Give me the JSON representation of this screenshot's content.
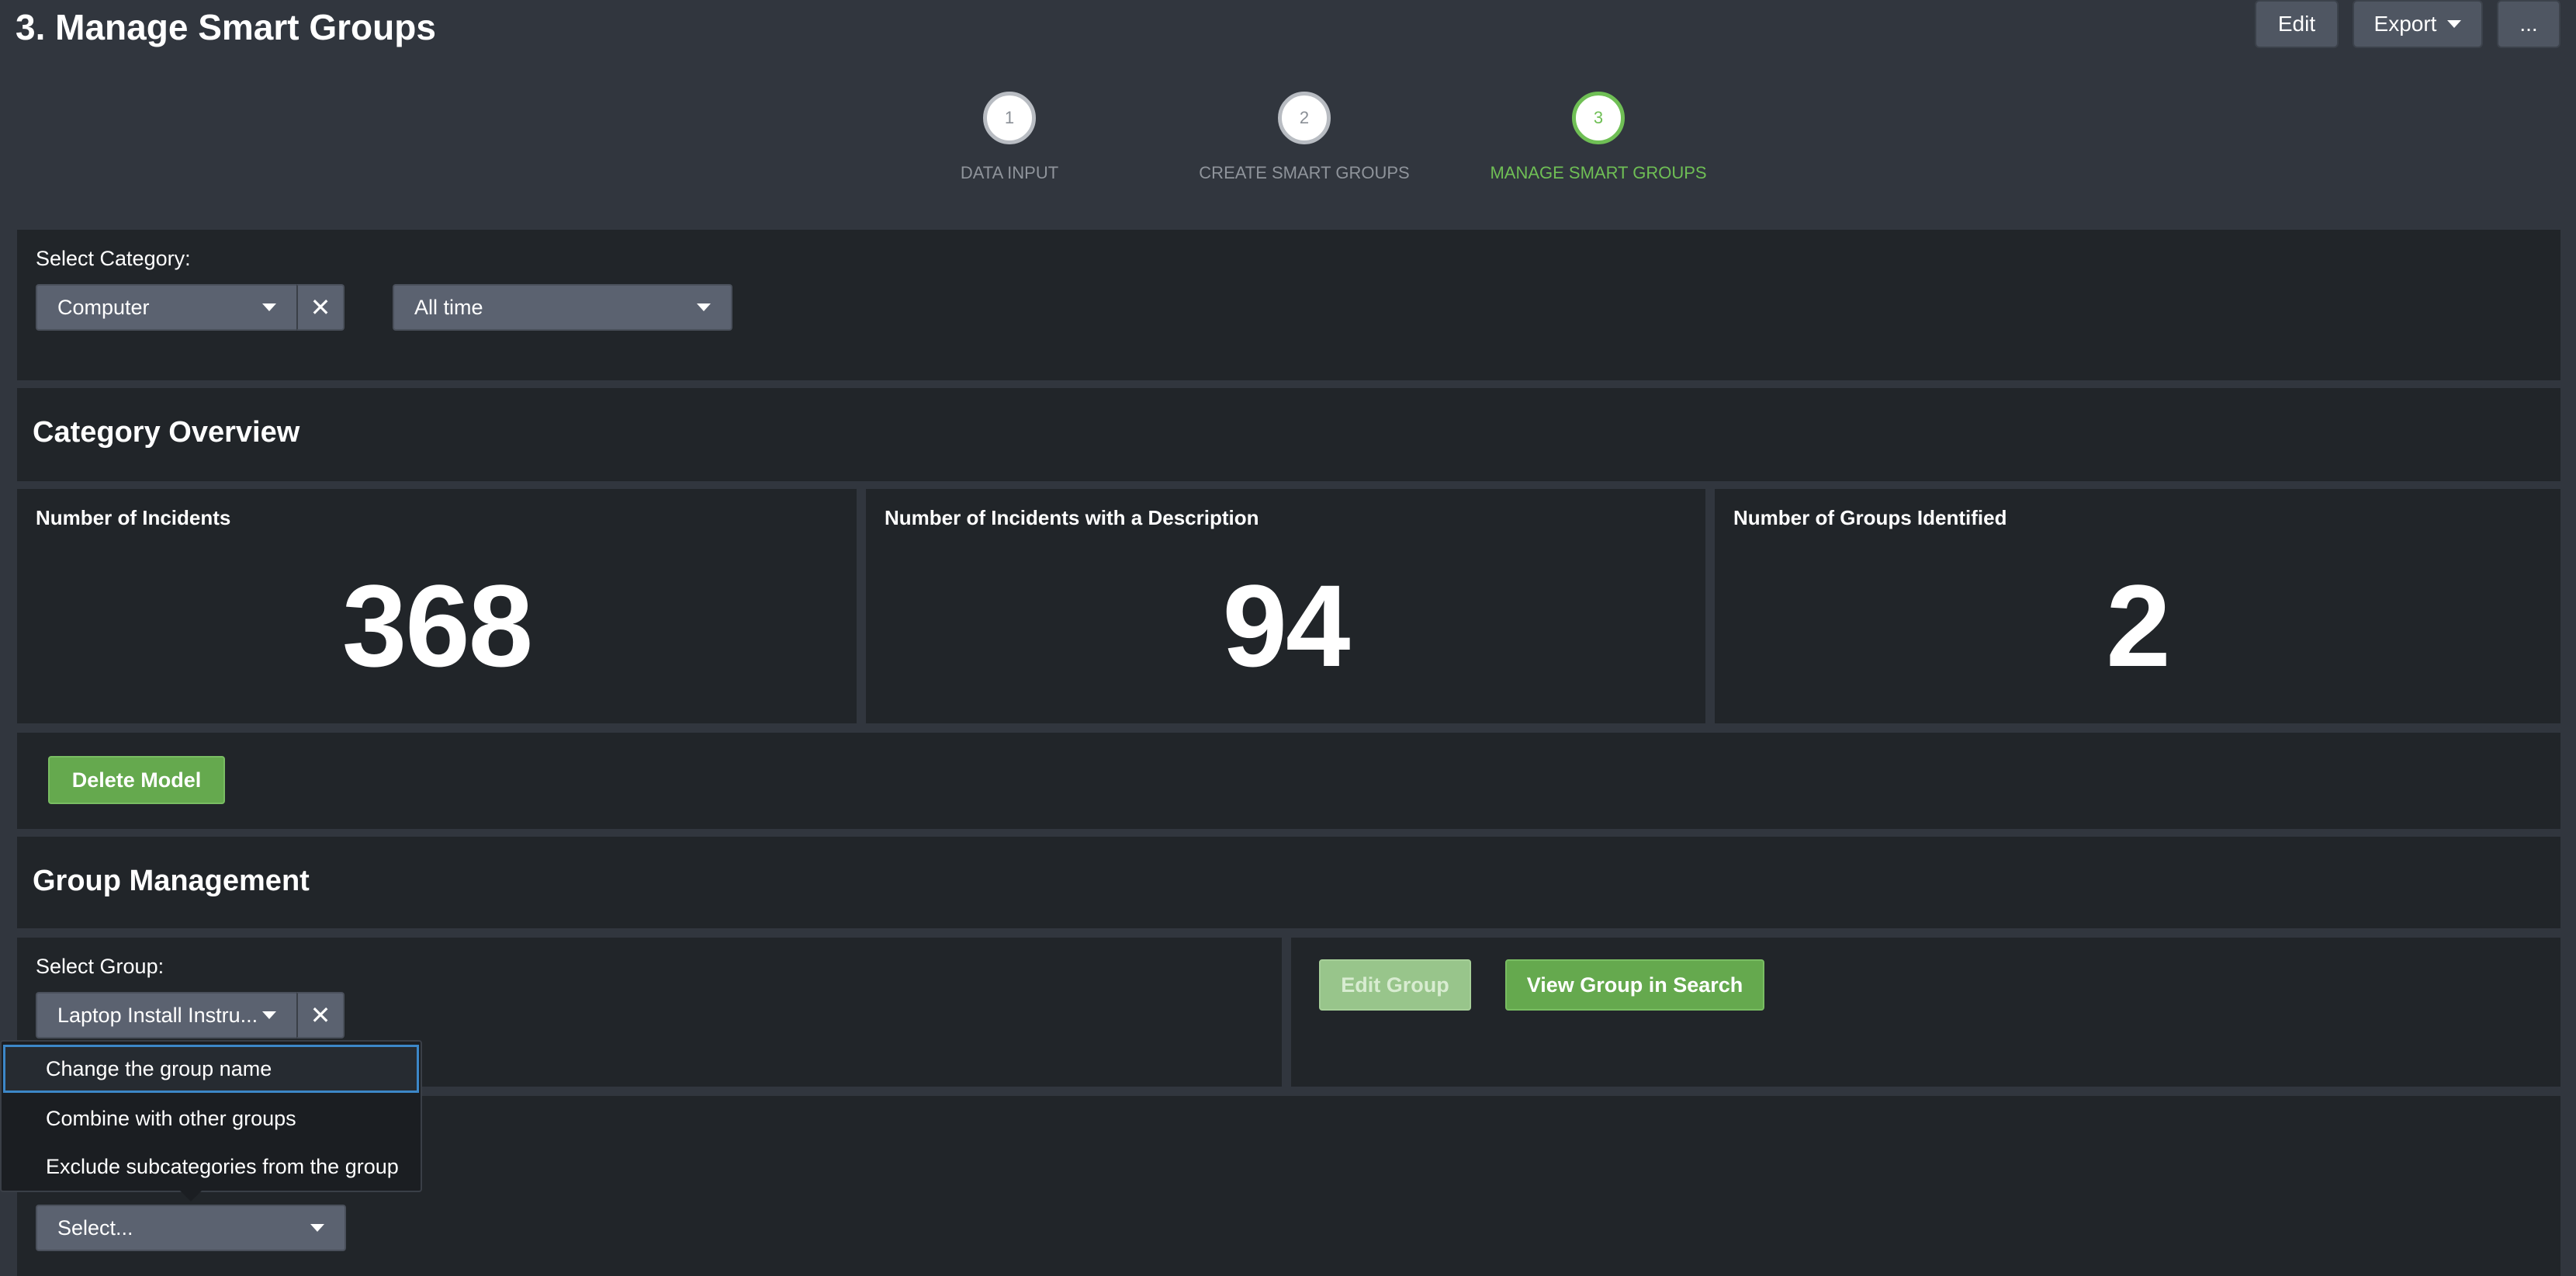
{
  "page": {
    "title": "3. Manage Smart Groups"
  },
  "toolbar": {
    "edit_label": "Edit",
    "export_label": "Export",
    "more_label": "..."
  },
  "steps": [
    {
      "number": "1",
      "label": "DATA INPUT"
    },
    {
      "number": "2",
      "label": "CREATE SMART GROUPS"
    },
    {
      "number": "3",
      "label": "MANAGE SMART GROUPS",
      "active": true
    }
  ],
  "filters": {
    "category_label": "Select Category:",
    "category_value": "Computer",
    "time_value": "All time"
  },
  "overview": {
    "title": "Category Overview",
    "stats": [
      {
        "label": "Number of Incidents",
        "value": "368"
      },
      {
        "label": "Number of Incidents with a Description",
        "value": "94"
      },
      {
        "label": "Number of Groups Identified",
        "value": "2"
      }
    ],
    "delete_label": "Delete Model"
  },
  "group_management": {
    "title": "Group Management",
    "select_label": "Select Group:",
    "group_value": "Laptop Install Instru...",
    "edit_group_label": "Edit Group",
    "view_group_label": "View Group in Search",
    "action_placeholder": "Select..."
  },
  "action_menu": {
    "items": [
      "Change the group name",
      "Combine with other groups",
      "Exclude subcategories from the group"
    ]
  },
  "colors": {
    "accent_green": "#65a94e",
    "active_step": "#6fbf55",
    "focus_blue": "#3c87c8"
  }
}
